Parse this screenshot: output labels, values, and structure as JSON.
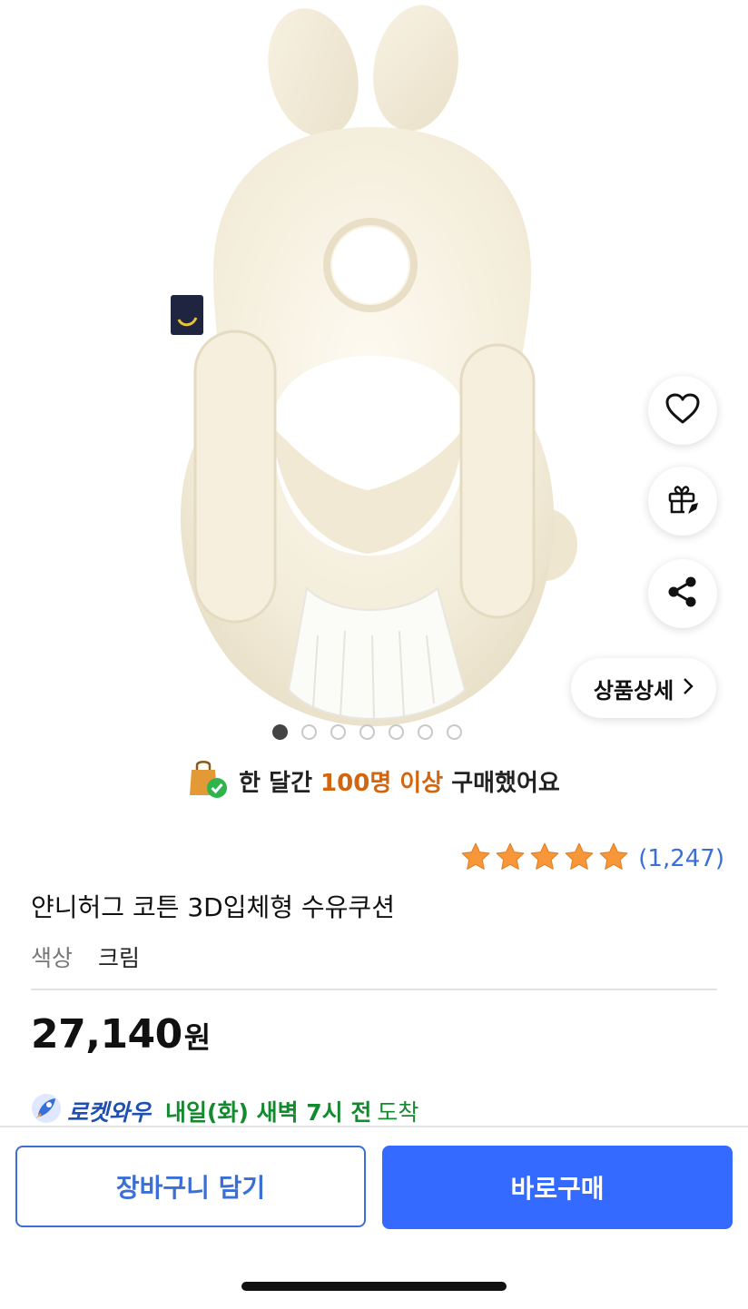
{
  "product": {
    "image_alt": "rabbit nursing cushion",
    "carousel": {
      "total": 7,
      "active": 1
    },
    "detail_chip_label": "상품상세"
  },
  "actions": {
    "wishlist_icon": "heart-icon",
    "gift_icon": "gift-icon",
    "share_icon": "share-icon"
  },
  "social_proof": {
    "prefix": "한 달간",
    "highlight": "100명 이상",
    "suffix": "구매했어요"
  },
  "rating": {
    "stars": 5,
    "count_text": "(1,247)"
  },
  "title": "얀니허그 코튼 3D입체형 수유쿠션",
  "option": {
    "label": "색상",
    "value": "크림"
  },
  "price": {
    "amount": "27,140",
    "unit": "원"
  },
  "delivery": {
    "brand": "로켓와우",
    "eta": "내일(화) 새벽 7시 전",
    "arrive": "도착"
  },
  "buttons": {
    "cart": "장바구니 담기",
    "buy": "바로구매"
  },
  "colors": {
    "accent": "#346aff",
    "rating_count": "#3a6fd6",
    "highlight": "#d3650e",
    "delivery_green": "#148a2f",
    "star": "#f7973a"
  }
}
